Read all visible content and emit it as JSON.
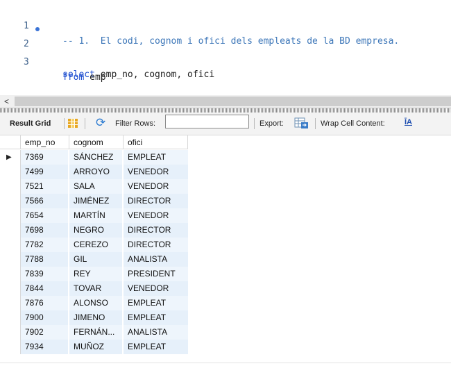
{
  "editor": {
    "lines": [
      {
        "num": "1",
        "text": "-- 1.  El codi, cognom i ofici dels empleats de la BD empresa."
      },
      {
        "num": "2",
        "kw": "select",
        "rest": " emp_no, cognom, ofici"
      },
      {
        "num": "3",
        "kw": "from",
        "rest": " emp"
      }
    ]
  },
  "scrollbar": {
    "left_arrow": "<"
  },
  "toolbar": {
    "result_grid": "Result Grid",
    "filter_rows": "Filter Rows:",
    "filter_value": "",
    "export": "Export:",
    "wrap": "Wrap Cell Content:",
    "wrap_icon": "ĪA"
  },
  "icons": {
    "grid": "grid-icon",
    "refresh": "refresh-icon",
    "export": "export-icon",
    "wrap": "wrap-icon",
    "pointer": "row-pointer-icon",
    "breakpoint": "breakpoint-dot-icon"
  },
  "colors": {
    "keyword": "#1f4fd0",
    "comment": "#3c76b8",
    "row_bg": "#e6f0fa"
  },
  "grid": {
    "columns": [
      "emp_no",
      "cognom",
      "ofici"
    ],
    "rows": [
      [
        "7369",
        "SÁNCHEZ",
        "EMPLEAT"
      ],
      [
        "7499",
        "ARROYO",
        "VENEDOR"
      ],
      [
        "7521",
        "SALA",
        "VENEDOR"
      ],
      [
        "7566",
        "JIMÉNEZ",
        "DIRECTOR"
      ],
      [
        "7654",
        "MARTÍN",
        "VENEDOR"
      ],
      [
        "7698",
        "NEGRO",
        "DIRECTOR"
      ],
      [
        "7782",
        "CEREZO",
        "DIRECTOR"
      ],
      [
        "7788",
        "GIL",
        "ANALISTA"
      ],
      [
        "7839",
        "REY",
        "PRESIDENT"
      ],
      [
        "7844",
        "TOVAR",
        "VENEDOR"
      ],
      [
        "7876",
        "ALONSO",
        "EMPLEAT"
      ],
      [
        "7900",
        "JIMENO",
        "EMPLEAT"
      ],
      [
        "7902",
        "FERNÁN...",
        "ANALISTA"
      ],
      [
        "7934",
        "MUÑOZ",
        "EMPLEAT"
      ]
    ],
    "pointer": "▶"
  }
}
